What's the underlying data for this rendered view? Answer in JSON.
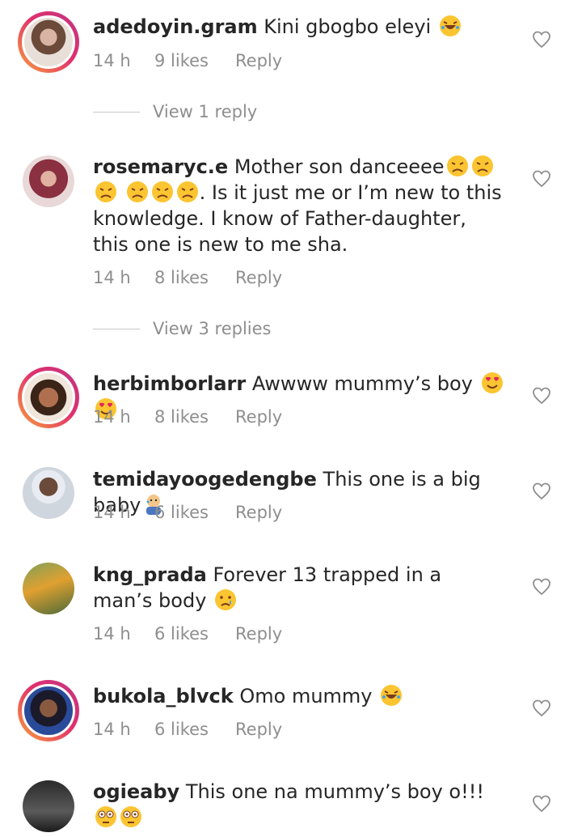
{
  "comments": [
    {
      "username": "adedoyin.gram",
      "text": "Kini gbogbo eleyi",
      "emojis": [
        "laugh"
      ],
      "time": "14 h",
      "likes": "9 likes",
      "reply": "Reply",
      "view_replies": "View 1 reply",
      "ring": true,
      "avatar_color": "#b07a6a"
    },
    {
      "username": "rosemaryc.e",
      "text_parts": [
        "Mother son danceeee",
        ". Is it just me or I’m new to this knowledge. I know of Father-daughter, this one is new to me sha."
      ],
      "time": "14 h",
      "likes": "8 likes",
      "reply": "Reply",
      "view_replies": "View 3 replies",
      "ring": false,
      "avatar_color": "#9a5a5a"
    },
    {
      "username": "herbimborlarr",
      "text": "Awwww mummy’s boy",
      "time": "14 h",
      "likes": "8 likes",
      "reply": "Reply",
      "ring": true,
      "avatar_color": "#5a3a2a"
    },
    {
      "username": "temidayoogedengbe",
      "text": "This one is a big baby",
      "time": "14 h",
      "likes": "6 likes",
      "reply": "Reply",
      "ring": false,
      "avatar_color": "#c8ced8"
    },
    {
      "username": "kng_prada",
      "text": "Forever 13 trapped in a man’s body",
      "time": "14 h",
      "likes": "6 likes",
      "reply": "Reply",
      "ring": false,
      "avatar_color": "#6f8a4a"
    },
    {
      "username": "bukola_blvck",
      "text": "Omo mummy",
      "time": "14 h",
      "likes": "6 likes",
      "reply": "Reply",
      "ring": true,
      "avatar_color": "#1d2a5a"
    },
    {
      "username": "ogieaby",
      "text": "This one na mummy’s boy o!!!",
      "time": "",
      "likes": "",
      "reply": "",
      "ring": false,
      "avatar_color": "#3a3a3a"
    }
  ],
  "icons": {
    "like": "heart-outline-icon"
  },
  "colors": {
    "text": "#262626",
    "meta": "#8e8e8e"
  }
}
